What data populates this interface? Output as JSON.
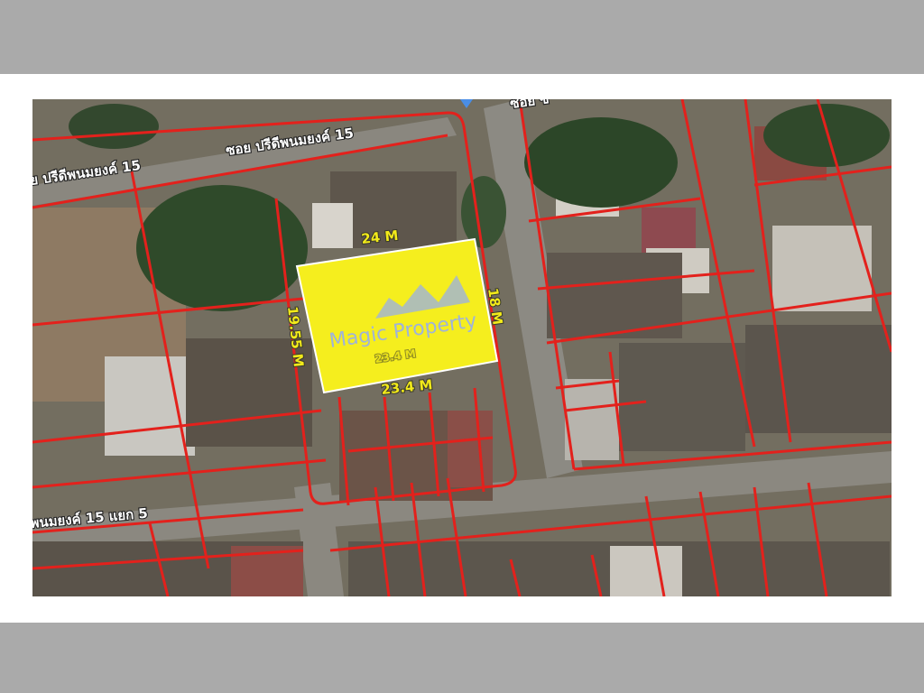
{
  "map": {
    "street_labels": [
      "ย ปรีดีพนมยงค์ 15",
      "ซอย ปรีดีพนมยงค์ 15",
      "ซอย ซ",
      "พนมยงค์ 15 แยก 5"
    ],
    "dimensions": {
      "top": "24 M",
      "right": "18 M",
      "left": "19.55 M",
      "bottom": "23.4 M",
      "inner_partial": "23.4 M"
    },
    "watermark": "Magic Property",
    "colors": {
      "plot_highlight": "#f5ee1e",
      "parcel_lines": "#e3211c",
      "dimension_text": "#f2ea1a",
      "watermark_text": "#9fb3d9"
    }
  }
}
